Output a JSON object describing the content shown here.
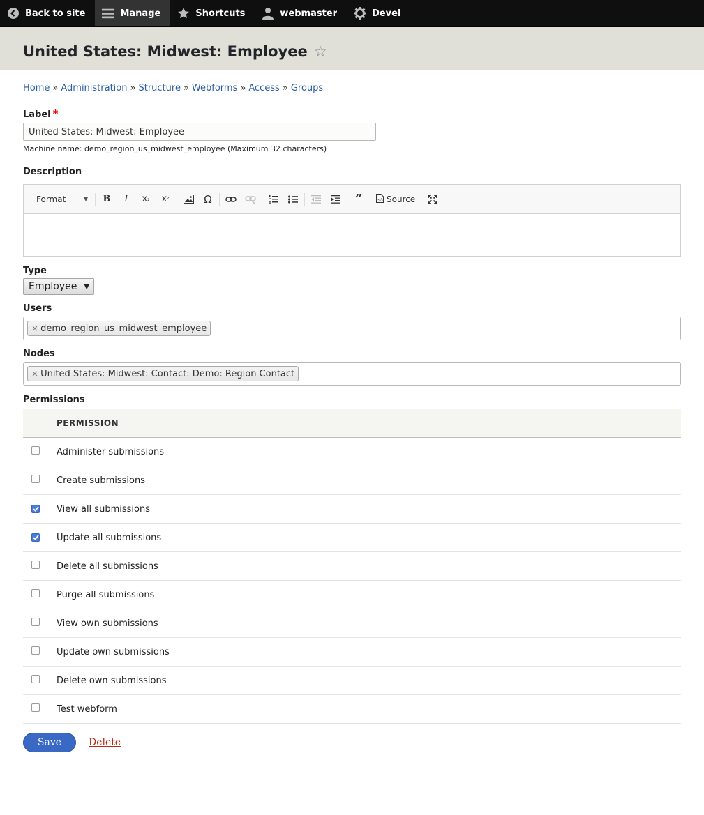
{
  "toolbar": {
    "back": "Back to site",
    "manage": "Manage",
    "shortcuts": "Shortcuts",
    "user": "webmaster",
    "devel": "Devel"
  },
  "page": {
    "title": "United States: Midwest: Employee"
  },
  "breadcrumb": [
    "Home",
    "Administration",
    "Structure",
    "Webforms",
    "Access",
    "Groups"
  ],
  "form": {
    "label": {
      "title": "Label",
      "required_mark": "*",
      "value": "United States: Midwest: Employee",
      "machine_name": "Machine name: demo_region_us_midwest_employee (Maximum 32 characters)"
    },
    "description": {
      "title": "Description",
      "format_label": "Format",
      "source_label": "Source"
    },
    "type": {
      "title": "Type",
      "value": "Employee"
    },
    "users": {
      "title": "Users",
      "values": [
        "demo_region_us_midwest_employee"
      ]
    },
    "nodes": {
      "title": "Nodes",
      "values": [
        "United States: Midwest: Contact: Demo: Region Contact"
      ]
    },
    "permissions": {
      "title": "Permissions",
      "header": "PERMISSION",
      "rows": [
        {
          "label": "Administer submissions",
          "checked": false
        },
        {
          "label": "Create submissions",
          "checked": false
        },
        {
          "label": "View all submissions",
          "checked": true
        },
        {
          "label": "Update all submissions",
          "checked": true
        },
        {
          "label": "Delete all submissions",
          "checked": false
        },
        {
          "label": "Purge all submissions",
          "checked": false
        },
        {
          "label": "View own submissions",
          "checked": false
        },
        {
          "label": "Update own submissions",
          "checked": false
        },
        {
          "label": "Delete own submissions",
          "checked": false
        },
        {
          "label": "Test webform",
          "checked": false
        }
      ]
    },
    "actions": {
      "save": "Save",
      "delete": "Delete"
    }
  },
  "colors": {
    "toolbar_bg": "#0f0f0f",
    "header_bg": "#e0e0d8",
    "link": "#2b5ea8",
    "primary_button": "#3969c4",
    "danger_link": "#b82a14"
  }
}
